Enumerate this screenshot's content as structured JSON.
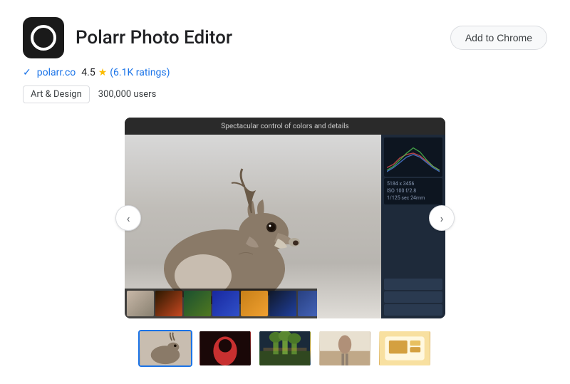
{
  "header": {
    "app_name": "Polarr Photo Editor",
    "add_to_chrome_label": "Add to Chrome"
  },
  "meta": {
    "website": "polarr.co",
    "rating": "4.5",
    "star_symbol": "★",
    "ratings_count": "(6.1K ratings)"
  },
  "tags": {
    "category": "Art & Design",
    "users": "300,000 users"
  },
  "screenshot": {
    "title": "Spectacular control of colors and details",
    "panel_info_line1": "5184 x 3456",
    "panel_info_line2": "ISO 100 f/2.8",
    "panel_info_line3": "1/125 sec 24mm"
  },
  "carousel": {
    "left_arrow": "‹",
    "right_arrow": "›"
  },
  "thumbnails": [
    {
      "id": 1,
      "active": true
    },
    {
      "id": 2,
      "active": false
    },
    {
      "id": 3,
      "active": false
    },
    {
      "id": 4,
      "active": false
    },
    {
      "id": 5,
      "active": false
    }
  ]
}
